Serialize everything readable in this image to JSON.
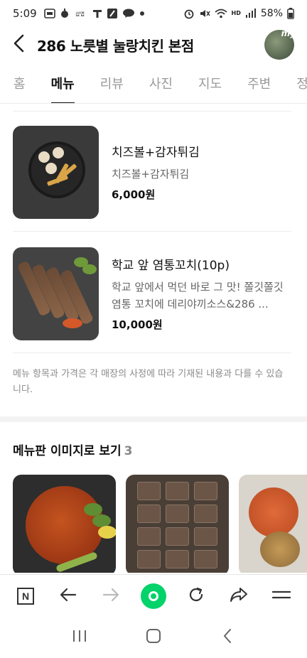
{
  "status_bar": {
    "time": "5:09",
    "battery": "58%",
    "network": "HD"
  },
  "header": {
    "title": "286 노릇별 눌랑치킨 본점",
    "avatar_text": "my"
  },
  "tabs": [
    {
      "label": "홈",
      "active": false
    },
    {
      "label": "메뉴",
      "active": true
    },
    {
      "label": "리뷰",
      "active": false
    },
    {
      "label": "사진",
      "active": false
    },
    {
      "label": "지도",
      "active": false
    },
    {
      "label": "주변",
      "active": false
    },
    {
      "label": "정",
      "active": false
    }
  ],
  "menu_items": [
    {
      "name": "치즈볼+감자튀김",
      "description": "치즈볼+감자튀김",
      "price": "6,000원"
    },
    {
      "name": "학교 앞 염통꼬치(10p)",
      "description": "학교 앞에서 먹던 바로 그 맛! 쫄깃쫄깃 염통 꼬치에 데리야끼소스&286 ...",
      "price": "10,000원"
    }
  ],
  "notice": "메뉴 항목과 가격은 각 매장의 사정에 따라 기재된 내용과 다를 수 있습니다.",
  "menu_board": {
    "title": "메뉴판 이미지로 보기",
    "count": "3"
  },
  "colors": {
    "accent_green": "#03d36a",
    "tab_active": "#111111",
    "tab_inactive": "#9a9a9a"
  }
}
